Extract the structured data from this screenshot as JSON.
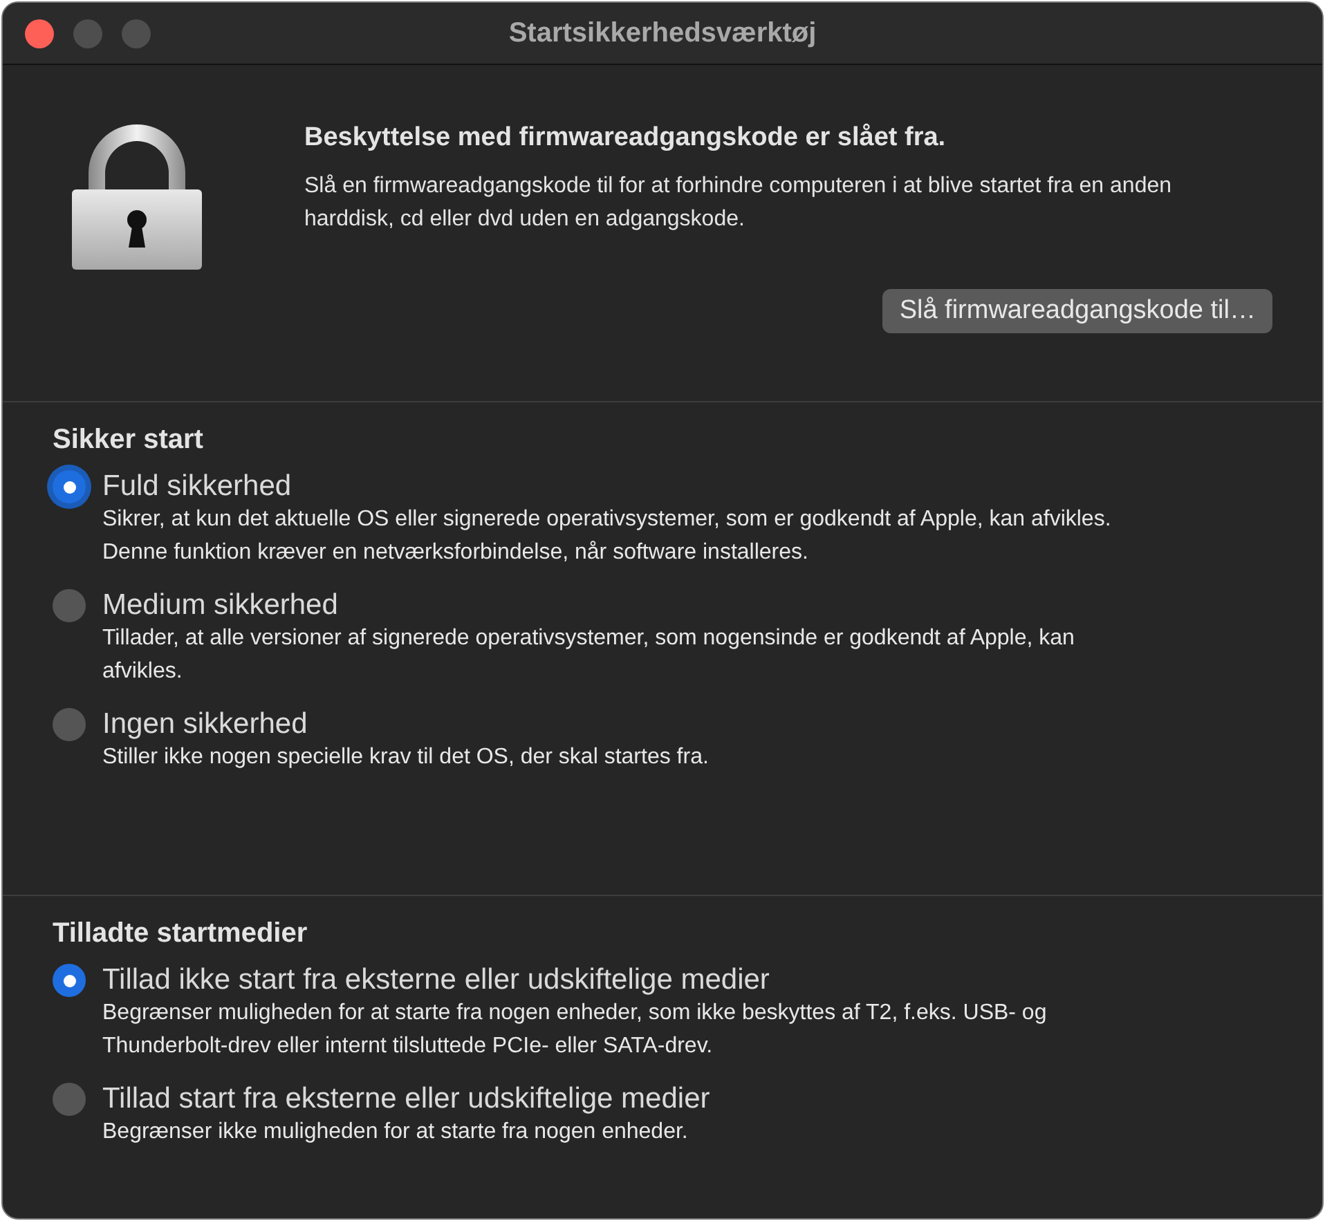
{
  "window": {
    "title": "Startsikkerhedsværktøj"
  },
  "firmware": {
    "heading": "Beskyttelse med firmwareadgangskode er slået fra.",
    "description": "Slå en firmwareadgangskode til for at forhindre computeren i at blive startet fra en anden harddisk, cd eller dvd uden en adgangskode.",
    "button": "Slå firmwareadgangskode til…"
  },
  "sections": [
    {
      "title": "Sikker start",
      "options": [
        {
          "label": "Fuld sikkerhed",
          "description": "Sikrer, at kun det aktuelle OS eller signerede operativsystemer, som er godkendt af Apple, kan afvikles. Denne funktion kræver en netværksforbindelse, når software installeres.",
          "selected": true,
          "focused": true
        },
        {
          "label": "Medium sikkerhed",
          "description": "Tillader, at alle versioner af signerede operativsystemer, som nogensinde er godkendt af Apple, kan afvikles.",
          "selected": false,
          "focused": false
        },
        {
          "label": "Ingen sikkerhed",
          "description": "Stiller ikke nogen specielle krav til det OS, der skal startes fra.",
          "selected": false,
          "focused": false
        }
      ]
    },
    {
      "title": "Tilladte startmedier",
      "options": [
        {
          "label": "Tillad ikke start fra eksterne eller udskiftelige medier",
          "description": "Begrænser muligheden for at starte fra nogen enheder, som ikke beskyttes af T2, f.eks. USB- og Thunderbolt-drev eller internt tilsluttede PCIe- eller SATA-drev.",
          "selected": true,
          "focused": false
        },
        {
          "label": "Tillad start fra eksterne eller udskiftelige medier",
          "description": "Begrænser ikke muligheden for at starte fra nogen enheder.",
          "selected": false,
          "focused": false
        }
      ]
    }
  ]
}
